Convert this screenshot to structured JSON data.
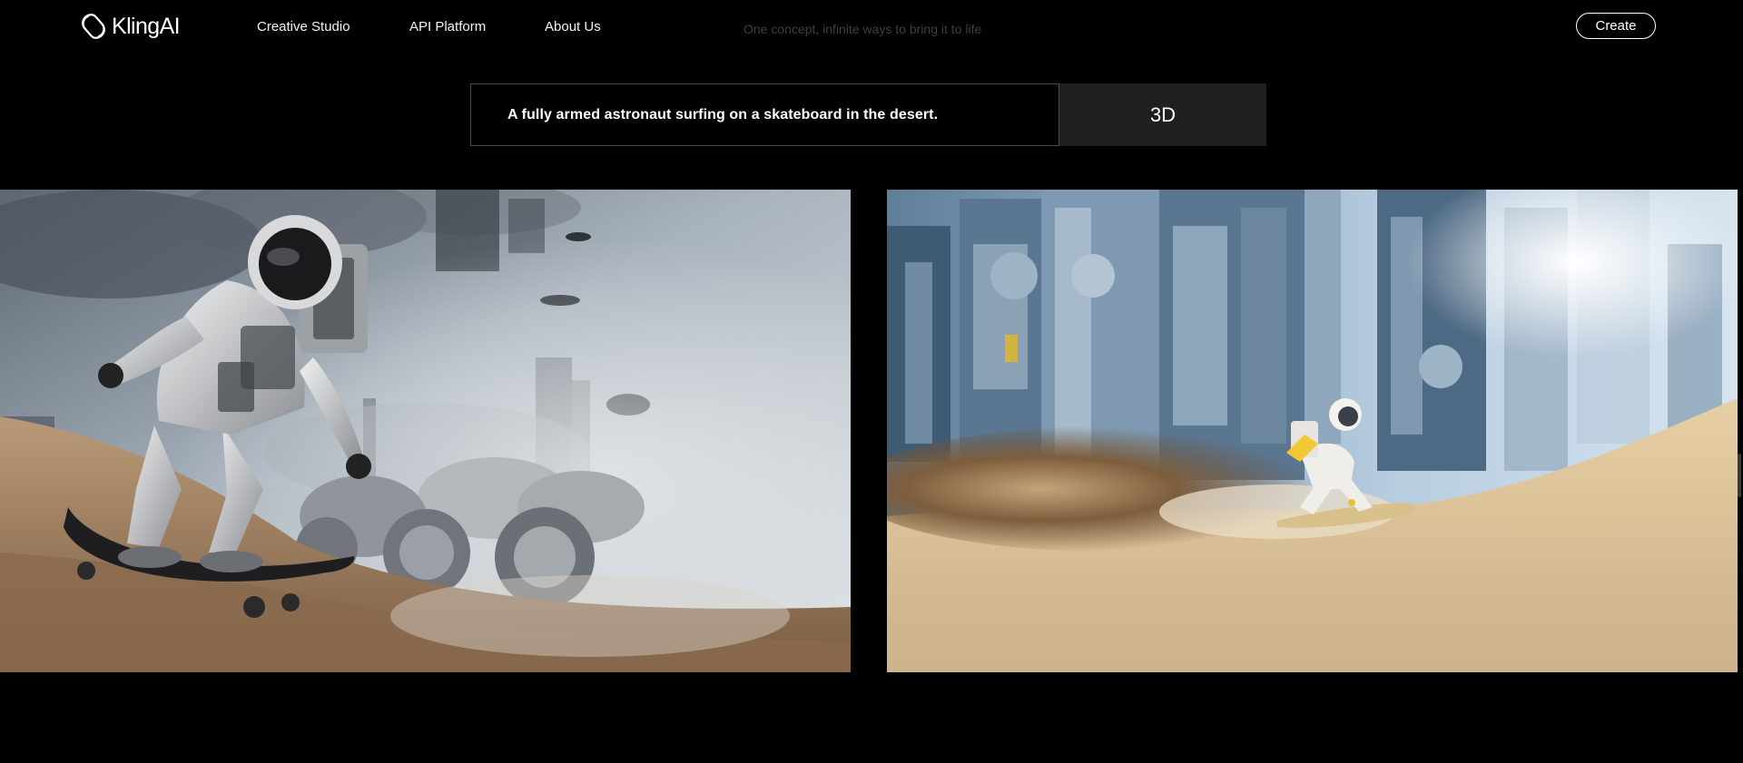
{
  "app": {
    "name": "KlingAI",
    "logo_icon": "kling-logo-icon"
  },
  "nav": {
    "items": [
      {
        "label": "Creative Studio"
      },
      {
        "label": "API Platform"
      },
      {
        "label": "About Us"
      }
    ]
  },
  "header": {
    "tagline": "One concept, infinite ways to bring it to life",
    "create_label": "Create"
  },
  "prompt": {
    "text": "A fully armed astronaut surfing on a skateboard in the desert.",
    "style": "3D"
  },
  "images": [
    {
      "subject": "astronaut-skateboarding-desert-realistic"
    },
    {
      "subject": "astronaut-sandboarding-futuristic-city-3d"
    }
  ],
  "colors": {
    "background": "#000000",
    "accent_text": "#ffffff",
    "tag_background": "#202020",
    "tagline": "#3f3f3f"
  }
}
